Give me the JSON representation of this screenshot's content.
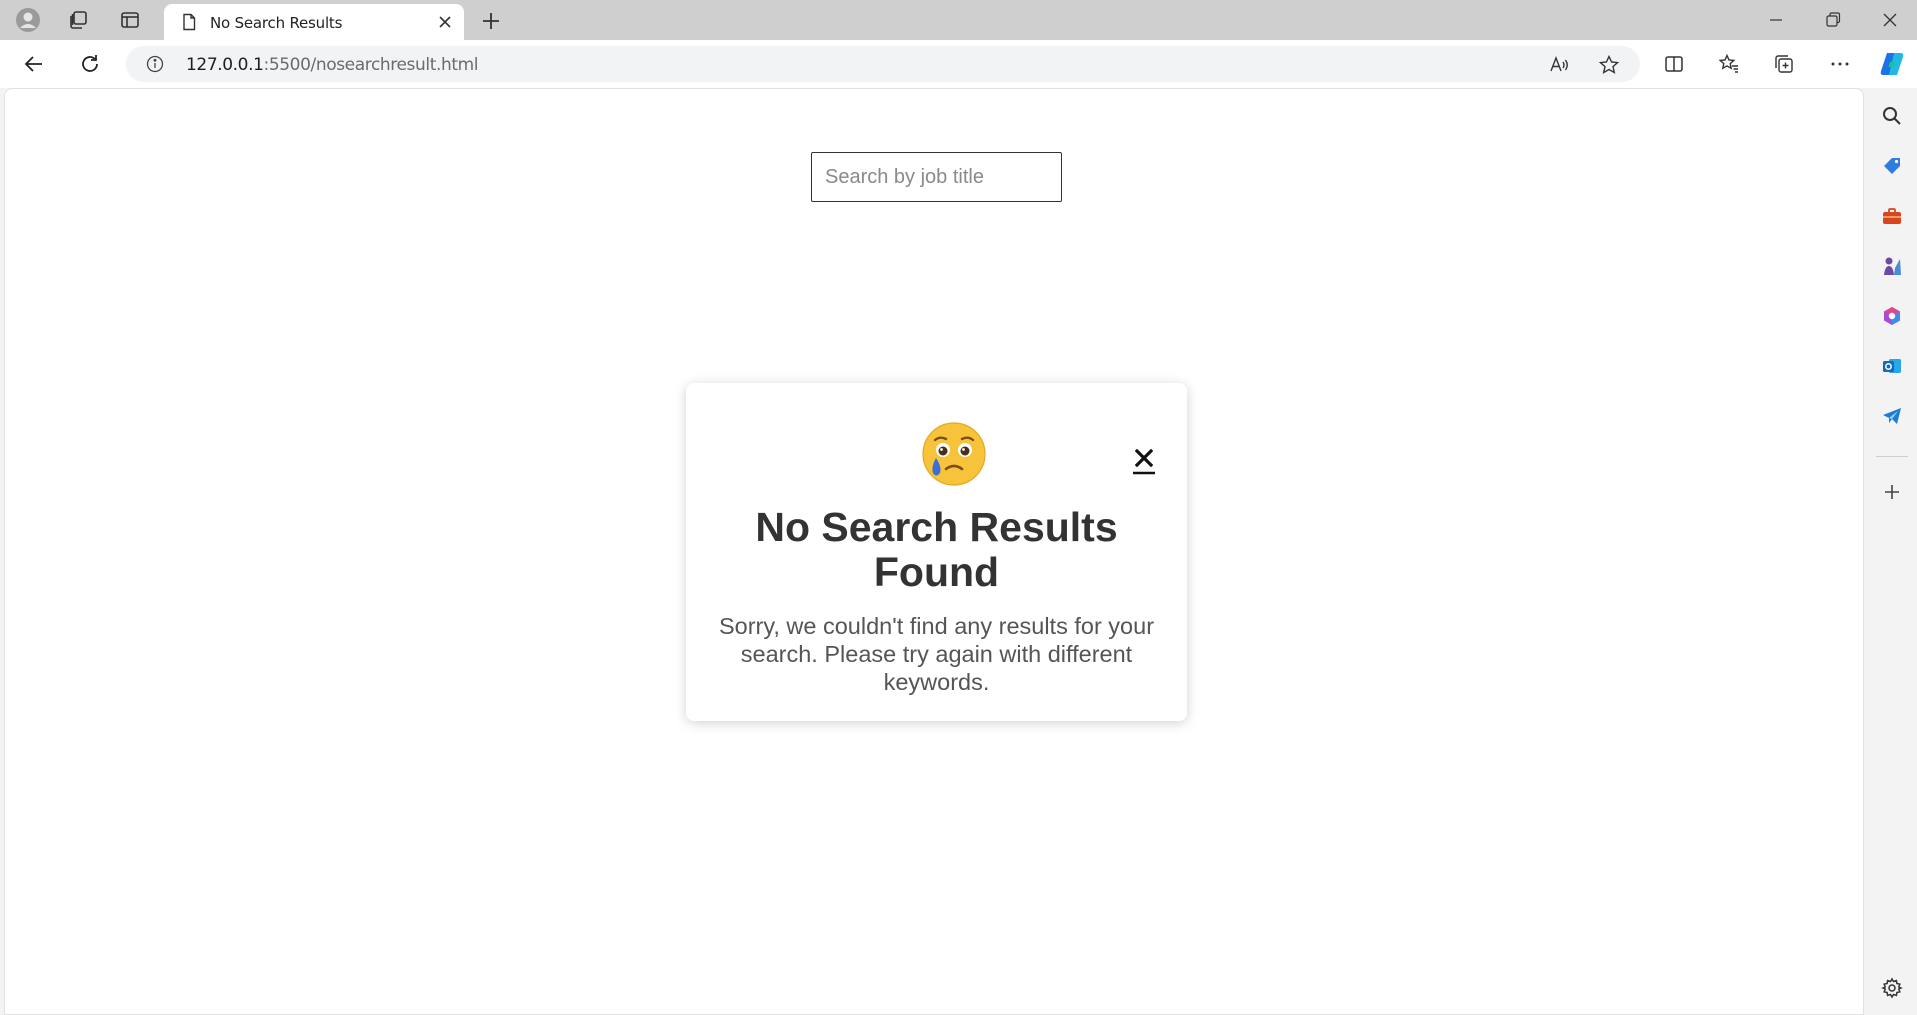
{
  "browser": {
    "tab": {
      "title": "No Search Results"
    },
    "address": {
      "host": "127.0.0.1",
      "path": ":5500/nosearchresult.html"
    }
  },
  "page": {
    "search": {
      "placeholder": "Search by job title",
      "value": ""
    },
    "modal": {
      "emoji": "sad-tear-emoji",
      "title": "No Search Results Found",
      "message": "Sorry, we couldn't find any results for your search. Please try again with different keywords.",
      "close_label": "×"
    }
  },
  "colors": {
    "titlebar": "#cfcfcf",
    "page_background": "#ffffff",
    "modal_title": "#333333",
    "modal_text": "#555555",
    "emoji_face": "#f7c33a",
    "tear": "#3b6fd6"
  },
  "icons": {
    "titlebar": [
      "profile-icon",
      "workspaces-icon",
      "vertical-tabs-icon",
      "page-icon",
      "close-icon",
      "new-tab-icon",
      "minimize-icon",
      "restore-icon",
      "window-close-icon"
    ],
    "toolbar": [
      "back-icon",
      "refresh-icon",
      "info-icon",
      "read-aloud-icon",
      "favorite-star-icon",
      "split-screen-icon",
      "favorites-icon",
      "collections-icon",
      "more-icon",
      "copilot-icon"
    ],
    "sidebar": [
      "search-icon",
      "shopping-tag-icon",
      "tools-icon",
      "games-icon",
      "microsoft365-icon",
      "outlook-icon",
      "telegram-icon",
      "add-icon",
      "settings-icon"
    ]
  }
}
